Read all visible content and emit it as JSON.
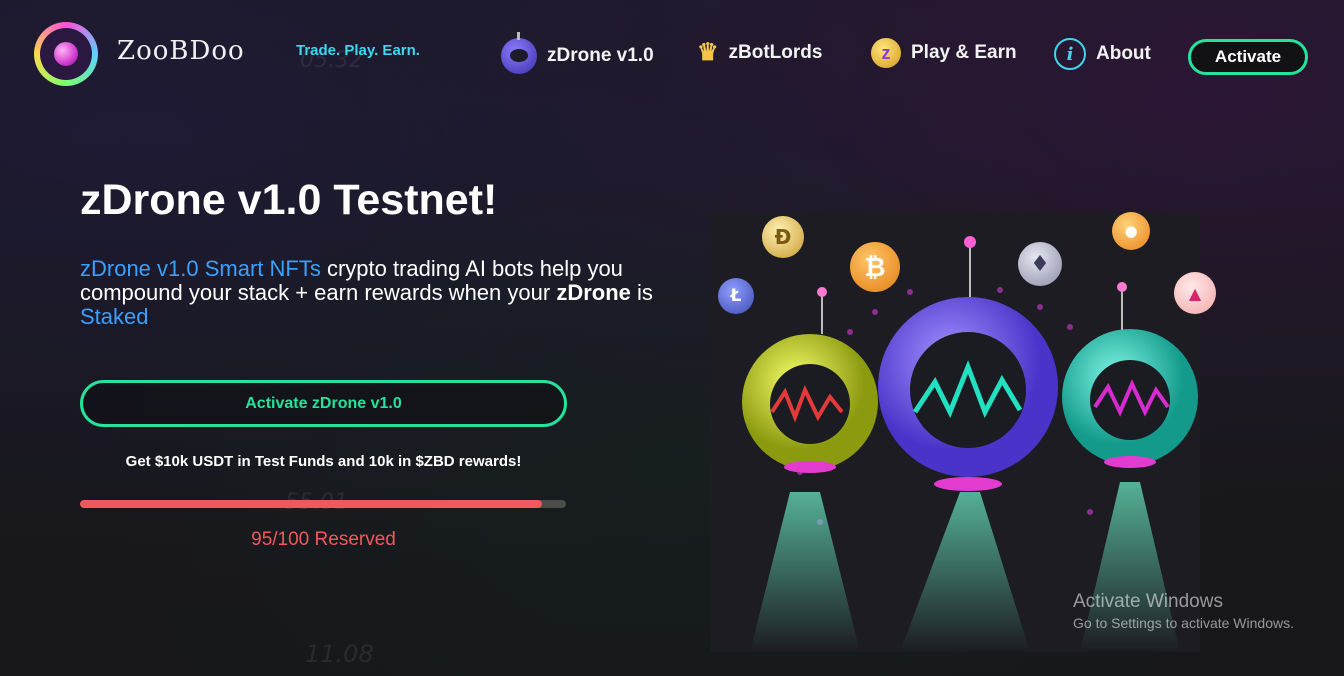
{
  "header": {
    "brand": "ZooBDoo",
    "tagline": "Trade. Play. Earn.",
    "nav": [
      {
        "label": "zDrone v1.0",
        "icon": "drone-icon"
      },
      {
        "label": "zBotLords",
        "icon": "crown-icon"
      },
      {
        "label": "Play & Earn",
        "icon": "z-coin-icon"
      },
      {
        "label": "About",
        "icon": "info-icon"
      }
    ],
    "activate_label": "Activate"
  },
  "hero": {
    "title": "zDrone v1.0 Testnet!",
    "desc_part1": "zDrone v1.0 Smart NFTs",
    "desc_part2": " crypto trading AI bots help you compound your stack + earn rewards when your ",
    "desc_part3": "zDrone",
    "desc_part4": " is ",
    "desc_part5": "Staked",
    "cta_label": "Activate zDrone v1.0",
    "promo": "Get $10k USDT in Test Funds and 10k in $ZBD rewards!",
    "progress_fraction": 0.95,
    "reserved_text": "95/100 Reserved"
  },
  "overlay": {
    "windows_title": "Activate Windows",
    "windows_sub": "Go to Settings to activate Windows."
  },
  "colors": {
    "accent_green": "#25e39a",
    "accent_blue": "#3aa0ff",
    "tagline_cyan": "#3fd6f0",
    "progress_red": "#f0585e"
  }
}
